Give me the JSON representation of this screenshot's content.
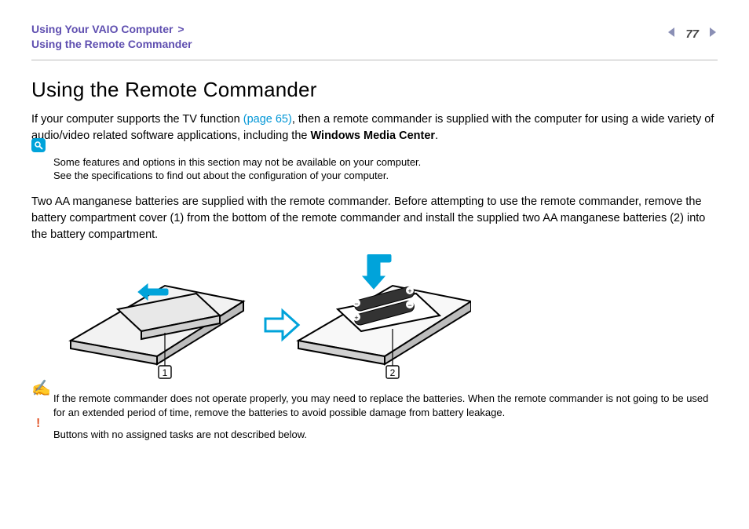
{
  "header": {
    "crumb1": "Using Your VAIO Computer",
    "gt": ">",
    "crumb2": "Using the Remote Commander",
    "page_number": "77"
  },
  "title": "Using the Remote Commander",
  "intro": {
    "before_link": "If your computer supports the TV function ",
    "link_text": "(page 65)",
    "after_link": ", then a remote commander is supplied with the computer for using a wide variety of audio/video related software applications, including the ",
    "bold": "Windows Media Center",
    "tail": "."
  },
  "spec_note": {
    "line1": "Some features and options in this section may not be available on your computer.",
    "line2": "See the specifications to find out about the configuration of your computer."
  },
  "para2": "Two AA manganese batteries are supplied with the remote commander. Before attempting to use the remote commander, remove the battery compartment cover (1) from the bottom of the remote commander and install the supplied two AA manganese batteries (2) into the battery compartment.",
  "callouts": {
    "one": "1",
    "two": "2"
  },
  "tip": "If the remote commander does not operate properly, you may need to replace the batteries. When the remote commander is not going to be used for an extended period of time, remove the batteries to avoid possible damage from battery leakage.",
  "warn": "Buttons with no assigned tasks are not described below."
}
